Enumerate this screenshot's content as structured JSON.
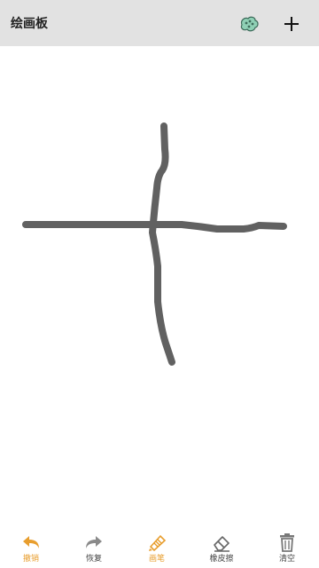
{
  "app": {
    "title": "绘画板"
  },
  "header": {
    "palette_icon": "palette-icon",
    "add_icon": "plus-icon"
  },
  "canvas": {
    "stroke_color": "#616161",
    "background": "#ffffff"
  },
  "toolbar": {
    "accent_color": "#e89e2e",
    "items": [
      {
        "label": "撤销",
        "icon": "undo-icon"
      },
      {
        "label": "恢复",
        "icon": "redo-icon"
      },
      {
        "label": "画笔",
        "icon": "brush-icon"
      },
      {
        "label": "橡皮擦",
        "icon": "eraser-icon"
      },
      {
        "label": "清空",
        "icon": "trash-icon"
      }
    ]
  }
}
